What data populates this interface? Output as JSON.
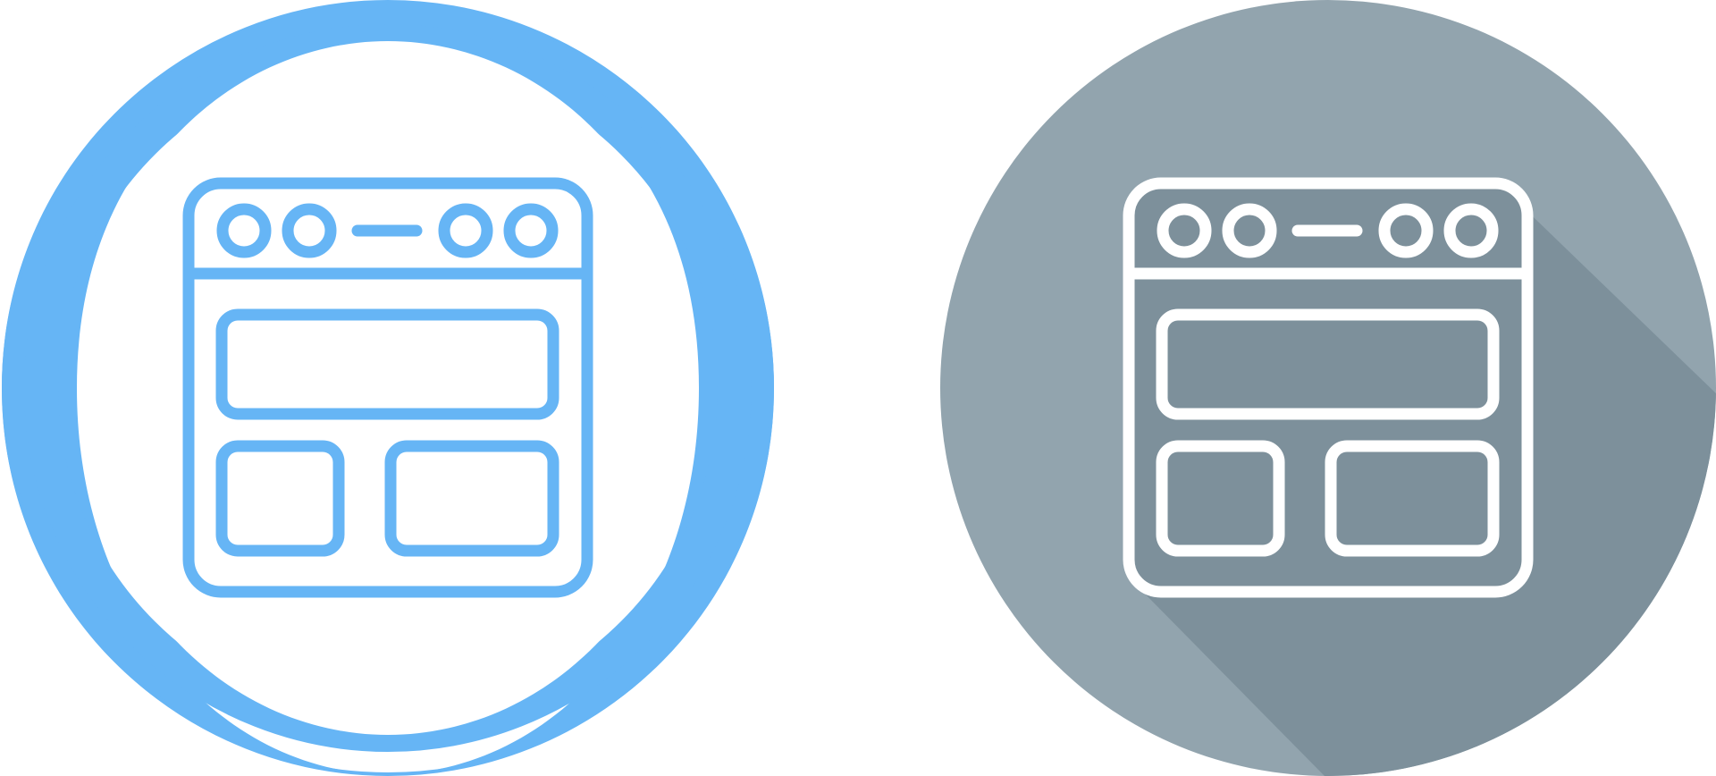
{
  "icons": [
    {
      "name": "web-layout-icon",
      "style": "outline",
      "colors": {
        "background": "#ffffff",
        "ring": "#66b5f5",
        "stroke": "#66b5f5"
      }
    },
    {
      "name": "web-layout-icon",
      "style": "flat-long-shadow",
      "colors": {
        "background": "#92a4ae",
        "shadow": "#7d909b",
        "stroke": "#ffffff"
      }
    }
  ]
}
